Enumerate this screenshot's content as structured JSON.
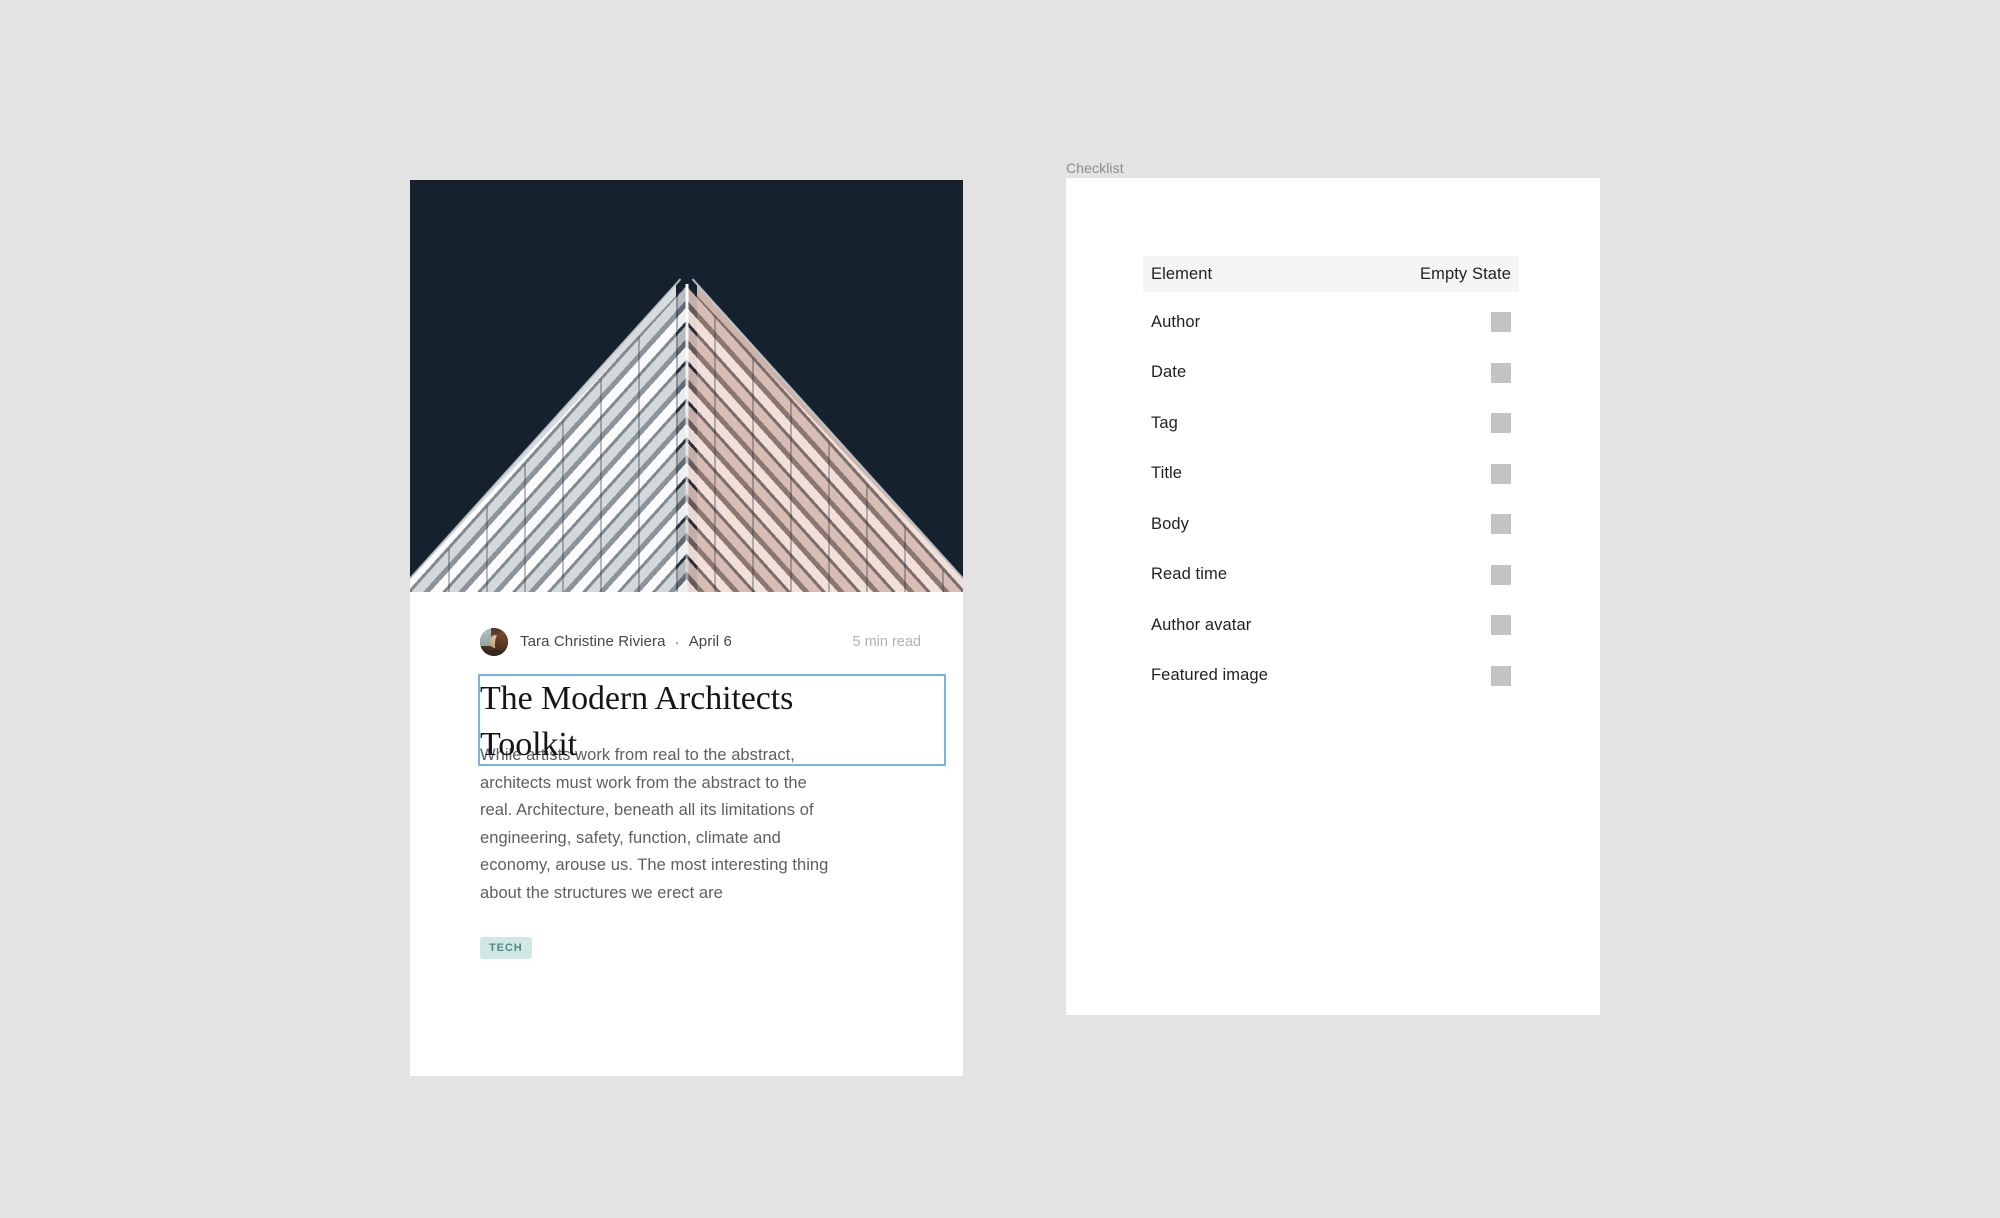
{
  "background_color": "#e3e3e3",
  "article": {
    "featured_image": {
      "alt": "architectural-building-corner",
      "sky_color": "#16212e",
      "left_face_color": "#d9dcdd",
      "right_face_color": "#cdb3a9"
    },
    "avatar_alt": "author-portrait",
    "author": "Tara Christine Riviera",
    "separator": "·",
    "date": "April 6",
    "read_time": "5 min read",
    "title": "The Modern Architects Toolkit",
    "body": "While artists work from real to the abstract, architects must work from the abstract to the real. Architecture, beneath all its limitations of engineering, safety, function, climate and economy, arouse us. The most interesting thing about the structures we erect are",
    "tag": "TECH",
    "tag_bg": "#cfe8e4",
    "tag_color": "#4e8a88",
    "selection_border_color": "#76b4e6"
  },
  "checklist": {
    "label": "Checklist",
    "columns": {
      "element": "Element",
      "empty_state": "Empty State"
    },
    "swatch_color": "#c3c3c3",
    "rows": [
      {
        "element": "Author"
      },
      {
        "element": "Date"
      },
      {
        "element": "Tag"
      },
      {
        "element": "Title"
      },
      {
        "element": "Body"
      },
      {
        "element": "Read time"
      },
      {
        "element": "Author avatar"
      },
      {
        "element": "Featured image"
      }
    ]
  }
}
